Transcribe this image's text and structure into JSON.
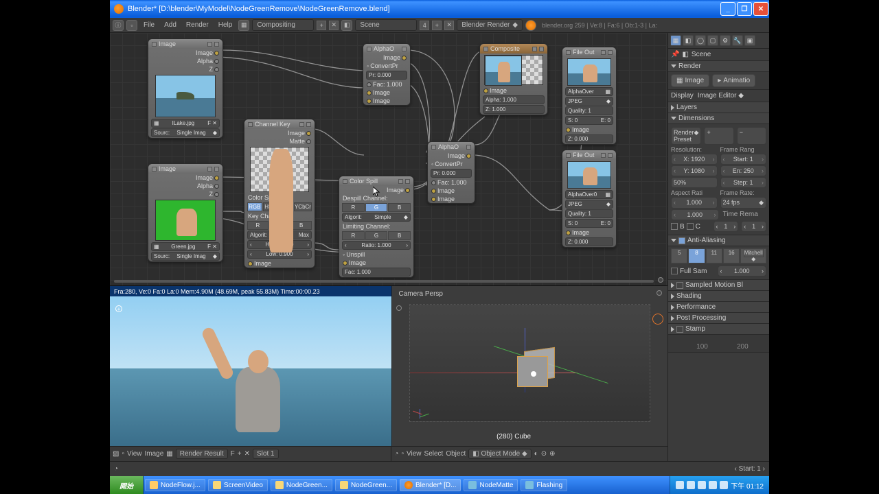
{
  "title": "Blender* [D:\\blender\\MyModel\\NodeGreenRemove\\NodeGreenRemove.blend]",
  "menu": {
    "file": "File",
    "add": "Add",
    "render": "Render",
    "help": "Help"
  },
  "header": {
    "layout": "Compositing",
    "scene": "Scene",
    "engine": "Blender Render",
    "stats": "blender.org 259 | Ve:8 | Fa:6 | Ob:1-3 | La:"
  },
  "nodes": {
    "image1": {
      "title": "Image",
      "image": "Image",
      "alpha": "Alpha",
      "z": "Z",
      "file": "ILake.jpg",
      "source": "Sourc:",
      "single": "Single Imag"
    },
    "image2": {
      "title": "Image",
      "image": "Image",
      "alpha": "Alpha",
      "z": "Z",
      "file": "Green.jpg",
      "source": "Sourc:",
      "single": "Single Imag"
    },
    "channelKey": {
      "title": "Channel Key",
      "image": "Image",
      "matte": "Matte",
      "colorSpace": "Color Space:",
      "rgb": "RGB",
      "hsv": "HSV",
      "yuv": "YUV",
      "ycbcr": "YCbCr",
      "keyChannel": "Key Channel:",
      "r": "R",
      "g": "G",
      "b": "B",
      "algorit": "Algorit:",
      "algVal": "Max",
      "high": "High: 1.000",
      "low": "Low: 0.900",
      "imageIn": "Image"
    },
    "alphaO1": {
      "title": "AlphaO",
      "image": "Image",
      "convert": "ConvertPr",
      "fac": "Fac: 1.000",
      "img1": "Image",
      "img2": "Image"
    },
    "alphaO2": {
      "title": "AlphaO",
      "image": "Image",
      "convert": "ConvertPr",
      "pr": "Pr: 0.000",
      "fac": "Fac: 1.000",
      "img1": "Image",
      "img2": "Image"
    },
    "colorSpill": {
      "title": "Color Spill",
      "image": "Image",
      "despill": "Despill Channel:",
      "r": "R",
      "g": "G",
      "b": "B",
      "algorit": "Algorit:",
      "algVal": "Simple",
      "limiting": "Limiting Channel:",
      "ratio": "Ratio: 1.000",
      "unspill": "Unspill",
      "imageIn": "Image",
      "fac": "Fac: 1.000"
    },
    "composite": {
      "title": "Composite",
      "image": "Image",
      "alpha": "Alpha: 1.000",
      "z": "Z: 1.000"
    },
    "fileOut1": {
      "title": "File Out",
      "alphaOver": "AlphaOver",
      "format": "JPEG",
      "quality": "Quality: 1",
      "s": "S: 0",
      "e": "E: 0",
      "image": "Image",
      "z": "Z: 0.000"
    },
    "fileOut2": {
      "title": "File Out",
      "alphaOver": "AlphaOver0",
      "format": "JPEG",
      "quality": "Quality: 1",
      "s": "S: 0",
      "e": "E: 0",
      "image": "Image",
      "z": "Z: 0.000"
    }
  },
  "imageViewer": {
    "info": "Fra:280, Ve:0 Fa:0 La:0 Mem:4.90M (48.69M, peak 55.83M) Time:00:00.23",
    "toolbar": {
      "view": "View",
      "image": "Image",
      "result": "Render Result",
      "slot": "Slot 1"
    }
  },
  "viewport3d": {
    "label": "Camera Persp",
    "object": "(280) Cube",
    "toolbar": {
      "view": "View",
      "select": "Select",
      "object": "Object",
      "mode": "Object Mode",
      "start": "Start: 1"
    }
  },
  "props": {
    "scene": "Scene",
    "render": {
      "header": "Render",
      "image": "Image",
      "animation": "Animatio",
      "display": "Display",
      "displayVal": "Image Editor"
    },
    "layers": "Layers",
    "dims": {
      "header": "Dimensions",
      "preset": "Render Preset",
      "res": "Resolution:",
      "frameRange": "Frame Rang",
      "x": "X: 1920",
      "start": "Start: 1",
      "y": "Y: 1080",
      "end": "En: 250",
      "pct": "50%",
      "step": "Step: 1",
      "aspect": "Aspect Rati",
      "fps": "Frame Rate:",
      "ar": "1.000",
      "fpsVal": "24 fps",
      "b": "B",
      "c": "C",
      "timeRema": "Time Rema",
      "one": "1"
    },
    "aa": {
      "header": "Anti-Aliasing",
      "samples5": "5",
      "samples8": "8",
      "samples11": "11",
      "samples16": "16",
      "filter": "Mitchell",
      "fullSam": "Full Sam",
      "val": "1.000"
    },
    "motion": "Sampled Motion Bl",
    "shading": "Shading",
    "performance": "Performance",
    "post": "Post Processing",
    "stamp": "Stamp",
    "timeline": {
      "t100": "100",
      "t200": "200"
    }
  },
  "taskbar": {
    "start": "開始",
    "tasks": [
      "NodeFlow.j...",
      "ScreenVideo",
      "NodeGreen...",
      "NodeGreen...",
      "Blender* [D...",
      "NodeMatte",
      "Flashing"
    ],
    "clock": "下午 01:12"
  }
}
